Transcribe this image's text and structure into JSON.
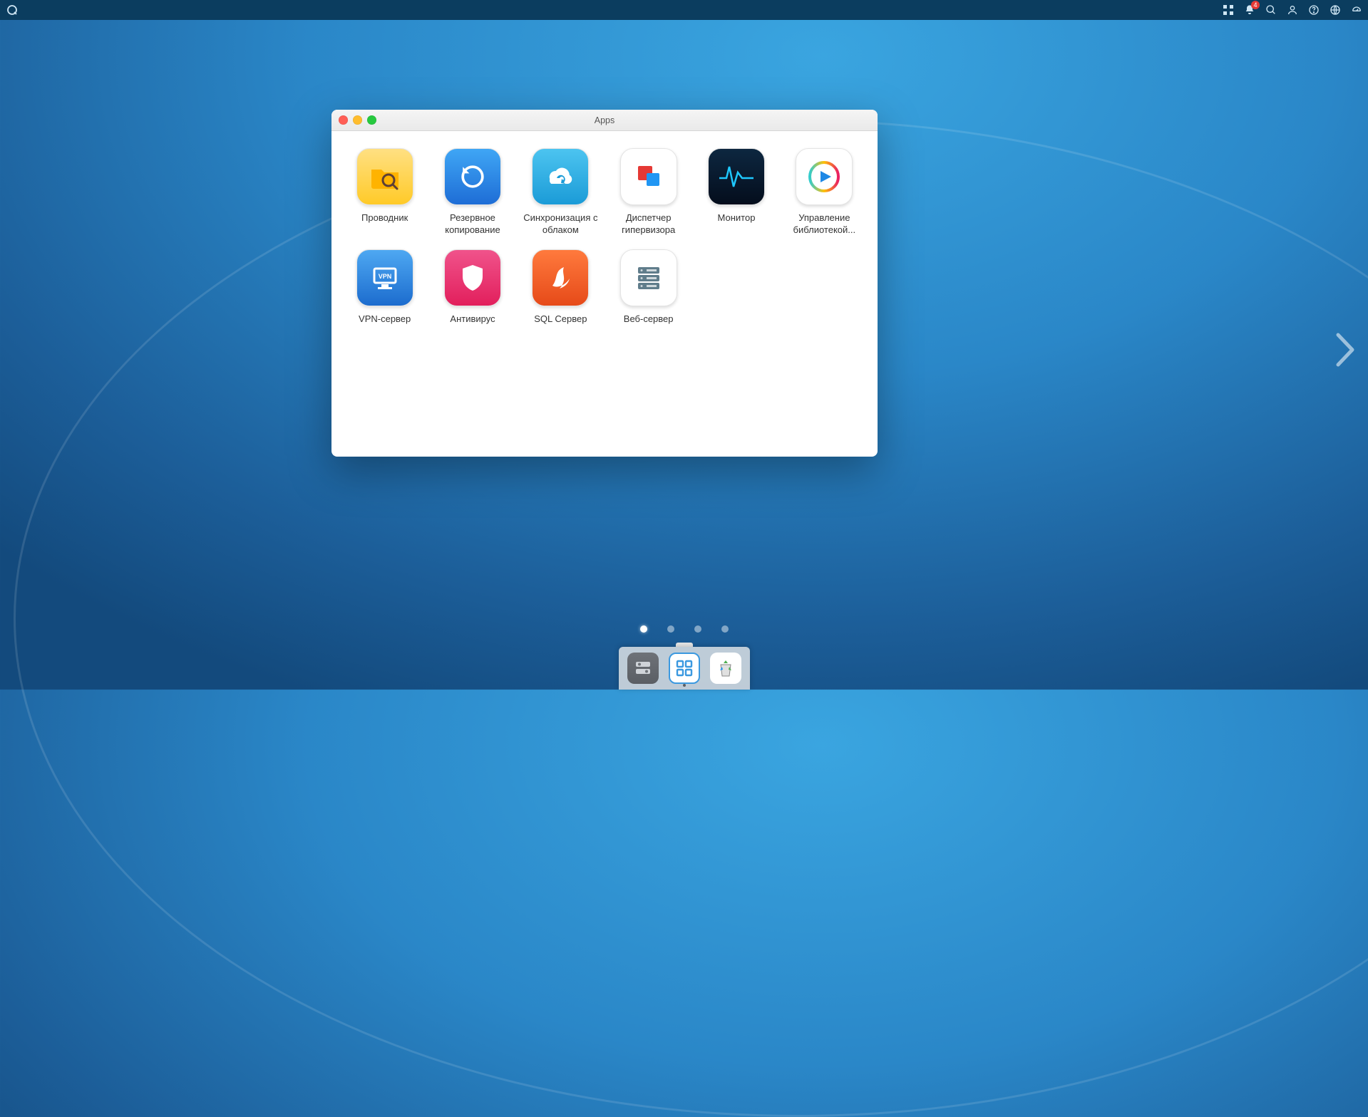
{
  "menubar": {
    "notification_count": "4"
  },
  "window": {
    "title": "Apps"
  },
  "apps": [
    {
      "label": "Проводник"
    },
    {
      "label": "Резервное копирование"
    },
    {
      "label": "Синхронизация с облаком"
    },
    {
      "label": "Диспетчер гипервизора"
    },
    {
      "label": "Монитор"
    },
    {
      "label": "Управление библиотекой..."
    },
    {
      "label": "VPN-сервер"
    },
    {
      "label": "Антивирус"
    },
    {
      "label": "SQL Сервер"
    },
    {
      "label": "Веб-сервер"
    }
  ],
  "desktop": {
    "page_count": 4,
    "active_page_index": 0
  }
}
